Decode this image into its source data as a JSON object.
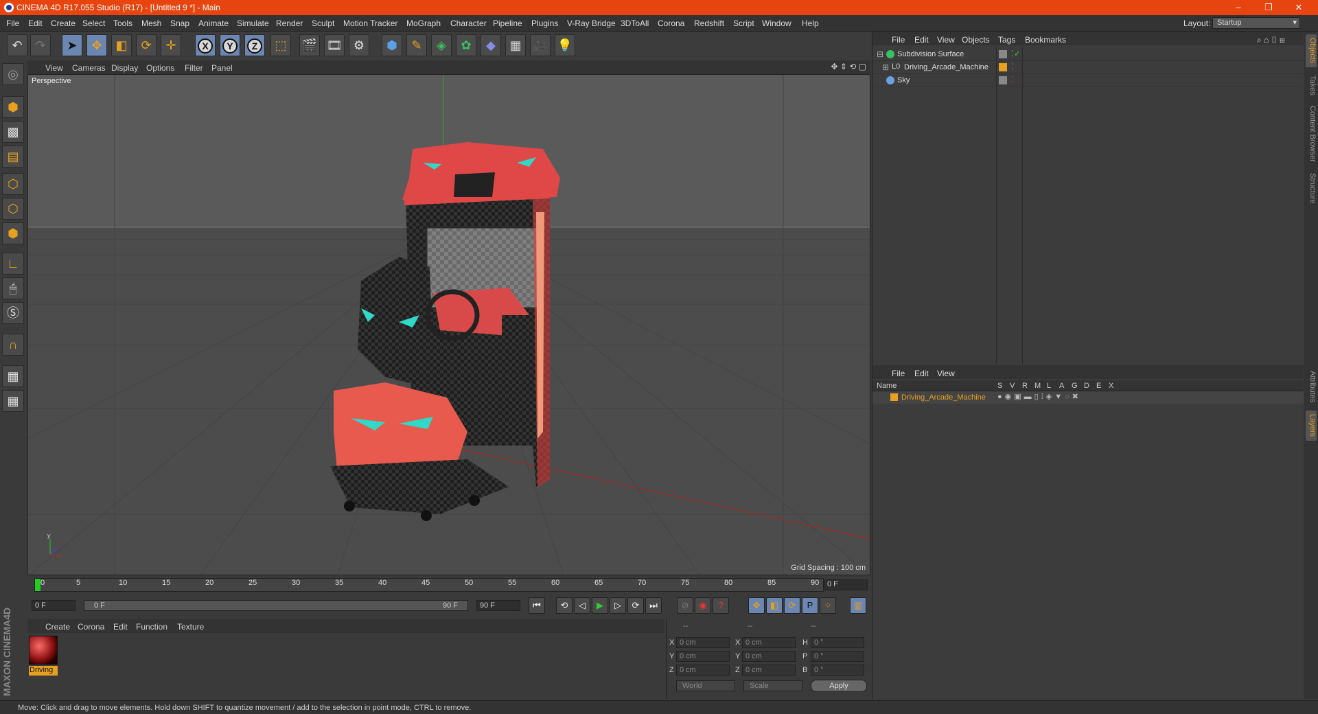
{
  "window": {
    "title": "CINEMA 4D R17.055 Studio (R17) - [Untitled 9 *] - Main"
  },
  "menubar": {
    "items": [
      "File",
      "Edit",
      "Create",
      "Select",
      "Tools",
      "Mesh",
      "Snap",
      "Animate",
      "Simulate",
      "Render",
      "Sculpt",
      "Motion Tracker",
      "MoGraph",
      "Character",
      "Pipeline",
      "Plugins",
      "V-Ray Bridge",
      "3DToAll",
      "Corona",
      "Redshift",
      "Script",
      "Window",
      "Help"
    ],
    "layout_label": "Layout:",
    "layout_value": "Startup"
  },
  "viewport": {
    "menu": [
      "View",
      "Cameras",
      "Display",
      "Options",
      "Filter",
      "Panel"
    ],
    "label": "Perspective",
    "grid_spacing": "Grid Spacing : 100 cm"
  },
  "timeline": {
    "ticks": [
      "0",
      "5",
      "10",
      "15",
      "20",
      "25",
      "30",
      "35",
      "40",
      "45",
      "50",
      "55",
      "60",
      "65",
      "70",
      "75",
      "80",
      "85",
      "90"
    ],
    "current_frame": "0 F",
    "start": "0 F",
    "range_start": "0 F",
    "range_end": "90 F",
    "end": "90 F"
  },
  "material": {
    "menu": [
      "Create",
      "Corona",
      "Edit",
      "Function",
      "Texture"
    ],
    "name": "Driving"
  },
  "brand": "MAXON CINEMA4D",
  "coords": {
    "headers": [
      "--",
      "--",
      "--"
    ],
    "rows": [
      {
        "a": "X",
        "av": "0 cm",
        "b": "X",
        "bv": "0 cm",
        "c": "H",
        "cv": "0 °"
      },
      {
        "a": "Y",
        "av": "0 cm",
        "b": "Y",
        "bv": "0 cm",
        "c": "P",
        "cv": "0 °"
      },
      {
        "a": "Z",
        "av": "0 cm",
        "b": "Z",
        "bv": "0 cm",
        "c": "B",
        "cv": "0 °"
      }
    ],
    "mode": "World",
    "scale": "Scale",
    "apply": "Apply"
  },
  "objects": {
    "menu": [
      "File",
      "Edit",
      "View",
      "Objects",
      "Tags",
      "Bookmarks"
    ],
    "items": [
      "Subdivision Surface",
      "Driving_Arcade_Machine",
      "Sky"
    ]
  },
  "layers": {
    "menu": [
      "File",
      "Edit",
      "View"
    ],
    "columns": [
      "Name",
      "S",
      "V",
      "R",
      "M",
      "L",
      "A",
      "G",
      "D",
      "E",
      "X"
    ],
    "item": "Driving_Arcade_Machine"
  },
  "right_tabs": [
    "Objects",
    "Takes",
    "Content Browser",
    "Structure",
    "Attributes",
    "Layers"
  ],
  "status": "Move: Click and drag to move elements. Hold down SHIFT to quantize movement / add to the selection in point mode, CTRL to remove.",
  "colors": {
    "accent": "#e8440f",
    "orange": "#e8a020",
    "viewport": "#5a5a5a",
    "model_red": "#e04848"
  }
}
